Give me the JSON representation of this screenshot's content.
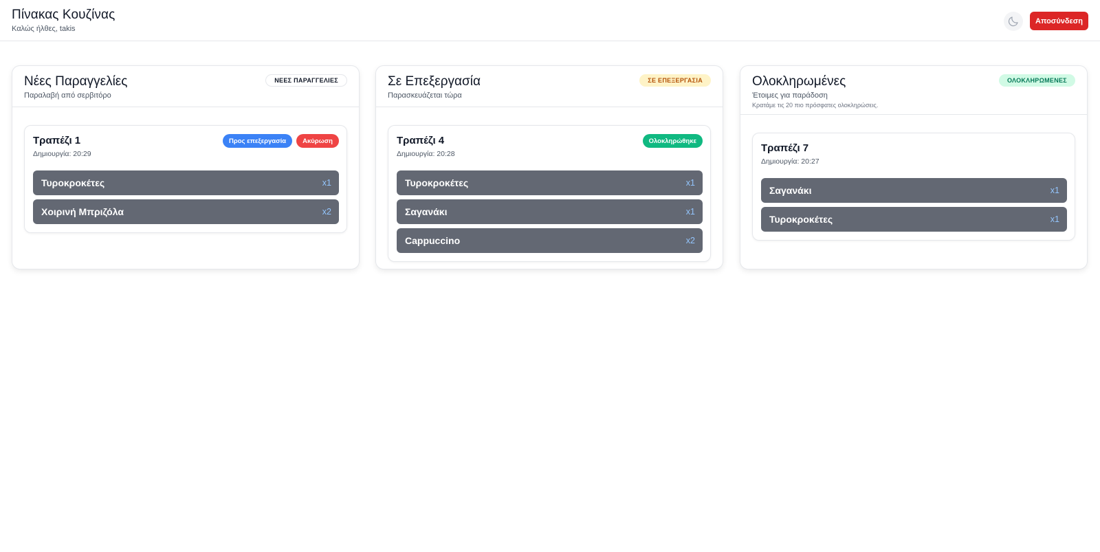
{
  "header": {
    "title": "Πίνακας Κουζίνας",
    "subtitle": "Καλώς ήλθες, takis",
    "theme_icon": "moon-icon",
    "logout_label": "Αποσύνδεση"
  },
  "colors": {
    "logout": "#dc2626",
    "process": "#3b82f6",
    "cancel": "#ef4444",
    "complete": "#10b981",
    "item_bg": "#636873",
    "qty": "#93c5fd"
  },
  "columns": [
    {
      "title": "Νέες Παραγγελίες",
      "subtitle": "Παραλαβή από σερβιτόρο",
      "badge": "ΝΕΕΣ ΠΑΡΑΓΓΕΛΙΕΣ",
      "orders": [
        {
          "table": "Τραπέζι 1",
          "created": "Δημιουργία: 20:29",
          "actions": [
            "Προς επεξεργασία",
            "Ακύρωση"
          ],
          "items": [
            {
              "name": "Τυροκροκέτες",
              "qty": "x1"
            },
            {
              "name": "Χοιρινή Μπριζόλα",
              "qty": "x2"
            }
          ]
        }
      ]
    },
    {
      "title": "Σε Επεξεργασία",
      "subtitle": "Παρασκευάζεται τώρα",
      "badge": "ΣΕ ΕΠΕΞΕΡΓΑΣΙΑ",
      "orders": [
        {
          "table": "Τραπέζι 4",
          "created": "Δημιουργία: 20:28",
          "actions": [
            "Ολοκληρώθηκε"
          ],
          "items": [
            {
              "name": "Τυροκροκέτες",
              "qty": "x1"
            },
            {
              "name": "Σαγανάκι",
              "qty": "x1"
            },
            {
              "name": "Cappuccino",
              "qty": "x2"
            }
          ]
        }
      ]
    },
    {
      "title": "Ολοκληρωμένες",
      "subtitle": "Έτοιμες για παράδοση",
      "note": "Κρατάμε τις 20 πιο πρόσφατες ολοκληρώσεις.",
      "badge": "ΟΛΟΚΛΗΡΩΜΕΝΕΣ",
      "orders": [
        {
          "table": "Τραπέζι 7",
          "created": "Δημιουργία: 20:27",
          "items": [
            {
              "name": "Σαγανάκι",
              "qty": "x1"
            },
            {
              "name": "Τυροκροκέτες",
              "qty": "x1"
            }
          ]
        }
      ]
    }
  ]
}
